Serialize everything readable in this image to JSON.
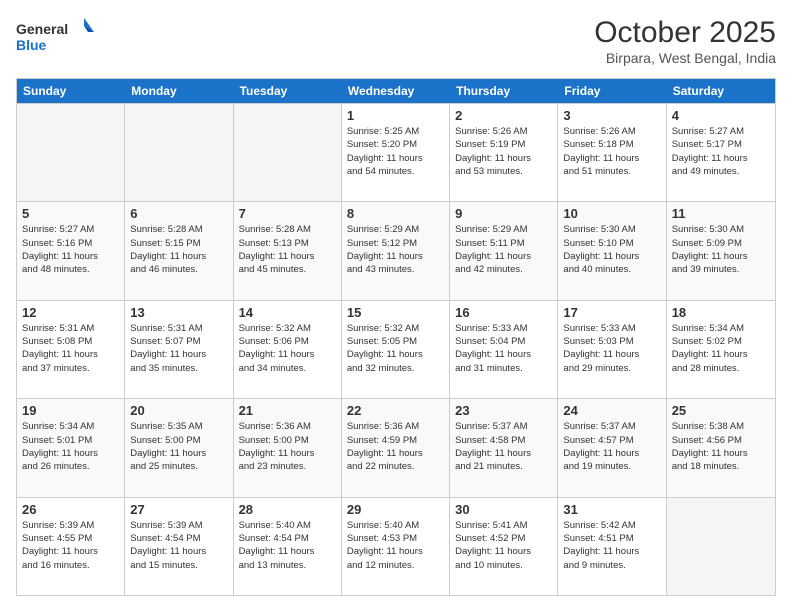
{
  "header": {
    "logo_line1": "General",
    "logo_line2": "Blue",
    "month": "October 2025",
    "location": "Birpara, West Bengal, India"
  },
  "weekdays": [
    "Sunday",
    "Monday",
    "Tuesday",
    "Wednesday",
    "Thursday",
    "Friday",
    "Saturday"
  ],
  "weeks": [
    [
      {
        "day": "",
        "info": ""
      },
      {
        "day": "",
        "info": ""
      },
      {
        "day": "",
        "info": ""
      },
      {
        "day": "1",
        "info": "Sunrise: 5:25 AM\nSunset: 5:20 PM\nDaylight: 11 hours\nand 54 minutes."
      },
      {
        "day": "2",
        "info": "Sunrise: 5:26 AM\nSunset: 5:19 PM\nDaylight: 11 hours\nand 53 minutes."
      },
      {
        "day": "3",
        "info": "Sunrise: 5:26 AM\nSunset: 5:18 PM\nDaylight: 11 hours\nand 51 minutes."
      },
      {
        "day": "4",
        "info": "Sunrise: 5:27 AM\nSunset: 5:17 PM\nDaylight: 11 hours\nand 49 minutes."
      }
    ],
    [
      {
        "day": "5",
        "info": "Sunrise: 5:27 AM\nSunset: 5:16 PM\nDaylight: 11 hours\nand 48 minutes."
      },
      {
        "day": "6",
        "info": "Sunrise: 5:28 AM\nSunset: 5:15 PM\nDaylight: 11 hours\nand 46 minutes."
      },
      {
        "day": "7",
        "info": "Sunrise: 5:28 AM\nSunset: 5:13 PM\nDaylight: 11 hours\nand 45 minutes."
      },
      {
        "day": "8",
        "info": "Sunrise: 5:29 AM\nSunset: 5:12 PM\nDaylight: 11 hours\nand 43 minutes."
      },
      {
        "day": "9",
        "info": "Sunrise: 5:29 AM\nSunset: 5:11 PM\nDaylight: 11 hours\nand 42 minutes."
      },
      {
        "day": "10",
        "info": "Sunrise: 5:30 AM\nSunset: 5:10 PM\nDaylight: 11 hours\nand 40 minutes."
      },
      {
        "day": "11",
        "info": "Sunrise: 5:30 AM\nSunset: 5:09 PM\nDaylight: 11 hours\nand 39 minutes."
      }
    ],
    [
      {
        "day": "12",
        "info": "Sunrise: 5:31 AM\nSunset: 5:08 PM\nDaylight: 11 hours\nand 37 minutes."
      },
      {
        "day": "13",
        "info": "Sunrise: 5:31 AM\nSunset: 5:07 PM\nDaylight: 11 hours\nand 35 minutes."
      },
      {
        "day": "14",
        "info": "Sunrise: 5:32 AM\nSunset: 5:06 PM\nDaylight: 11 hours\nand 34 minutes."
      },
      {
        "day": "15",
        "info": "Sunrise: 5:32 AM\nSunset: 5:05 PM\nDaylight: 11 hours\nand 32 minutes."
      },
      {
        "day": "16",
        "info": "Sunrise: 5:33 AM\nSunset: 5:04 PM\nDaylight: 11 hours\nand 31 minutes."
      },
      {
        "day": "17",
        "info": "Sunrise: 5:33 AM\nSunset: 5:03 PM\nDaylight: 11 hours\nand 29 minutes."
      },
      {
        "day": "18",
        "info": "Sunrise: 5:34 AM\nSunset: 5:02 PM\nDaylight: 11 hours\nand 28 minutes."
      }
    ],
    [
      {
        "day": "19",
        "info": "Sunrise: 5:34 AM\nSunset: 5:01 PM\nDaylight: 11 hours\nand 26 minutes."
      },
      {
        "day": "20",
        "info": "Sunrise: 5:35 AM\nSunset: 5:00 PM\nDaylight: 11 hours\nand 25 minutes."
      },
      {
        "day": "21",
        "info": "Sunrise: 5:36 AM\nSunset: 5:00 PM\nDaylight: 11 hours\nand 23 minutes."
      },
      {
        "day": "22",
        "info": "Sunrise: 5:36 AM\nSunset: 4:59 PM\nDaylight: 11 hours\nand 22 minutes."
      },
      {
        "day": "23",
        "info": "Sunrise: 5:37 AM\nSunset: 4:58 PM\nDaylight: 11 hours\nand 21 minutes."
      },
      {
        "day": "24",
        "info": "Sunrise: 5:37 AM\nSunset: 4:57 PM\nDaylight: 11 hours\nand 19 minutes."
      },
      {
        "day": "25",
        "info": "Sunrise: 5:38 AM\nSunset: 4:56 PM\nDaylight: 11 hours\nand 18 minutes."
      }
    ],
    [
      {
        "day": "26",
        "info": "Sunrise: 5:39 AM\nSunset: 4:55 PM\nDaylight: 11 hours\nand 16 minutes."
      },
      {
        "day": "27",
        "info": "Sunrise: 5:39 AM\nSunset: 4:54 PM\nDaylight: 11 hours\nand 15 minutes."
      },
      {
        "day": "28",
        "info": "Sunrise: 5:40 AM\nSunset: 4:54 PM\nDaylight: 11 hours\nand 13 minutes."
      },
      {
        "day": "29",
        "info": "Sunrise: 5:40 AM\nSunset: 4:53 PM\nDaylight: 11 hours\nand 12 minutes."
      },
      {
        "day": "30",
        "info": "Sunrise: 5:41 AM\nSunset: 4:52 PM\nDaylight: 11 hours\nand 10 minutes."
      },
      {
        "day": "31",
        "info": "Sunrise: 5:42 AM\nSunset: 4:51 PM\nDaylight: 11 hours\nand 9 minutes."
      },
      {
        "day": "",
        "info": ""
      }
    ]
  ]
}
